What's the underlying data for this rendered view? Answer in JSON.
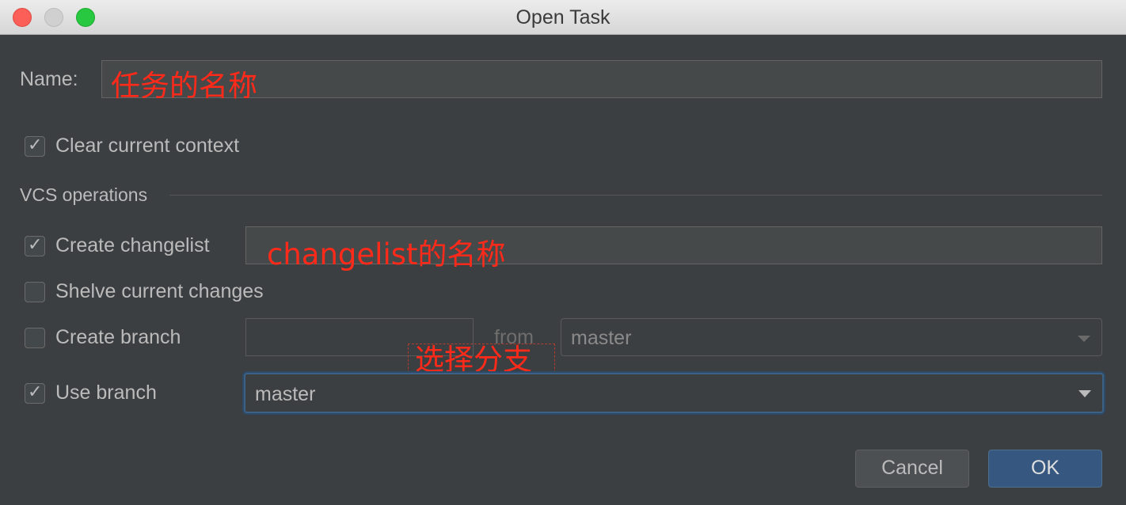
{
  "window": {
    "title": "Open Task"
  },
  "name_row": {
    "label": "Name:",
    "annotation": "任务的名称"
  },
  "clear_context": {
    "label": "Clear current context",
    "checked": true
  },
  "vcs": {
    "section_label": "VCS operations"
  },
  "create_changelist": {
    "label": "Create changelist",
    "checked": true,
    "annotation": "changelist的名称"
  },
  "shelve": {
    "label": "Shelve current changes",
    "checked": false
  },
  "create_branch": {
    "label": "Create branch",
    "checked": false,
    "from_label": "from",
    "from_value": "master"
  },
  "use_branch": {
    "label": "Use branch",
    "checked": true,
    "value": "master",
    "annotation": "选择分支"
  },
  "buttons": {
    "cancel": "Cancel",
    "ok": "OK"
  },
  "colors": {
    "annotation": "#ff2a1a",
    "ok_button": "#365880",
    "focus": "#3d6185"
  }
}
